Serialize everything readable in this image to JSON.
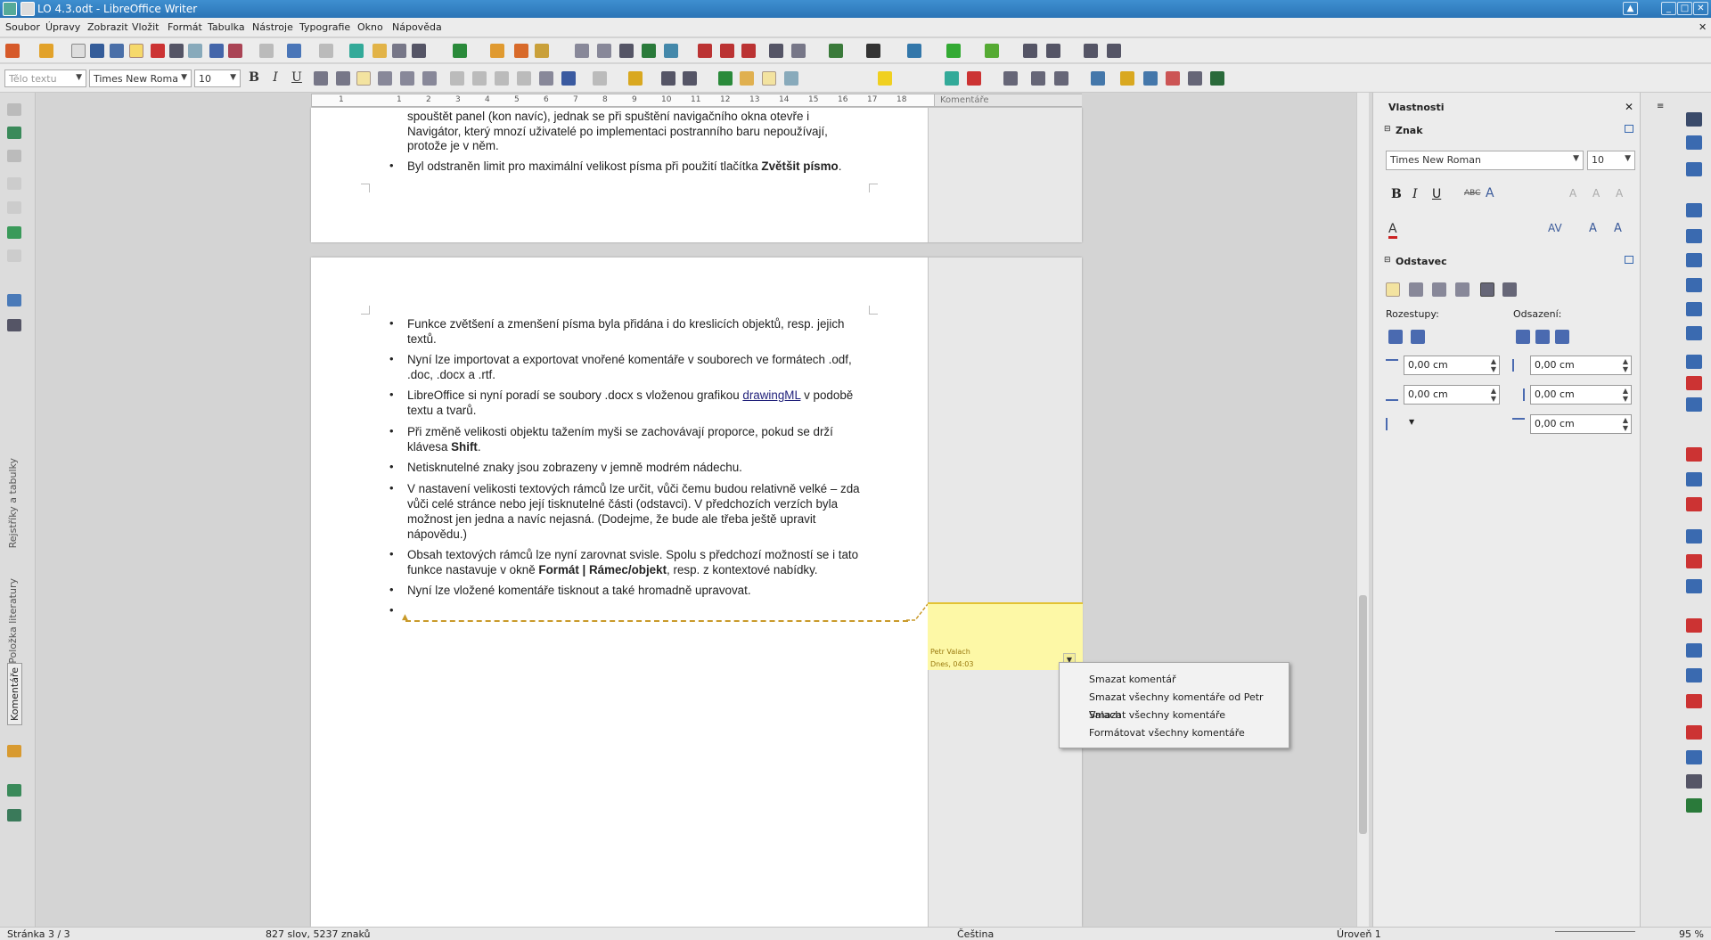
{
  "title_bar": {
    "title": "LO 4.3.odt - LibreOffice Writer"
  },
  "menu": [
    "Soubor",
    "Úpravy",
    "Zobrazit",
    "Vložit",
    "Formát",
    "Tabulka",
    "Nástroje",
    "Typografie",
    "Okno",
    "Nápověda"
  ],
  "toolbar": {
    "paragraph_style": "Tělo textu",
    "font_name": "Times New Roma",
    "font_size": "10",
    "bold": "B",
    "italic": "I",
    "underline": "U"
  },
  "ruler": {
    "comments_label": "Komentáře",
    "numbers": [
      "1",
      "1",
      "2",
      "3",
      "4",
      "5",
      "6",
      "7",
      "8",
      "9",
      "10",
      "11",
      "12",
      "13",
      "14",
      "15",
      "16",
      "17",
      "18"
    ]
  },
  "left_panel": {
    "tab_registers": "Rejstříky a tabulky",
    "tab_library": "Položka literatury",
    "tab_comments": "Komentáře"
  },
  "page1": {
    "line1": "spouštět panel (kon navíc), jednak se při spuštění navigačního okna otevře i",
    "line2": "Navigátor, který mnozí uživatelé po implementaci postranního baru nepoužívají,",
    "line3": "protože je v něm.",
    "bullet_plain": "Byl odstraněn limit pro maximální velikost písma při použití tlačítka ",
    "bullet_bold": "Zvětšit písmo",
    "bullet_end": "."
  },
  "page2": {
    "b1": "Funkce zvětšení a zmenšení písma byla přidána i do kreslicích objektů, resp. jejich textů.",
    "b2": "Nyní lze importovat a exportovat vnořené komentáře v souborech ve formátech .odf, .doc, .docx a .rtf.",
    "b3_pre": "LibreOffice si nyní poradí se soubory .docx s vloženou grafikou ",
    "b3_link": "drawingML",
    "b3_post": " v podobě textu a tvarů.",
    "b4_pre": "Při změně velikosti objektu tažením myši se zachovávají proporce, pokud se drží klávesa ",
    "b4_bold": "Shift",
    "b4_post": ".",
    "b5": "Netisknutelné znaky jsou zobrazeny v jemně modrém nádechu.",
    "b6": "V nastavení velikosti textových rámců lze určit, vůči čemu budou relativně velké – zda vůči celé stránce nebo její tisknutelné části (odstavci). V předchozích verzích byla možnost jen jedna a navíc nejasná. (Dodejme, že bude ale třeba ještě upravit nápovědu.)",
    "b7_pre": "Obsah textových rámců lze nyní zarovnat svisle. Spolu s předchozí možností se i tato funkce nastavuje v okně ",
    "b7_bold": "Formát | Rámec/objekt",
    "b7_post": ", resp. z kontextové nabídky.",
    "b8": "Nyní lze vložené komentáře tisknout a také hromadně upravovat.",
    "bullet": "•"
  },
  "comment": {
    "author": "Petr Valach",
    "date": "Dnes, 04:03"
  },
  "context_menu": [
    "Smazat komentář",
    "Smazat všechny komentáře od Petr Valach",
    "Smazat všechny komentáře",
    "Formátovat všechny komentáře"
  ],
  "sidebar": {
    "title": "Vlastnosti",
    "char_section": "Znak",
    "font_name": "Times New Roman",
    "font_size": "10",
    "para_section": "Odstavec",
    "spacing_label": "Rozestupy:",
    "indent_label": "Odsazení:",
    "above": "0,00 cm",
    "below": "0,00 cm",
    "before": "0,00 cm",
    "after": "0,00 cm",
    "first_line": "0,00 cm"
  },
  "status": {
    "page": "Stránka 3 / 3",
    "words": "827 slov, 5237 znaků",
    "language": "Čeština",
    "level": "Úroveň 1",
    "zoom": "95 %"
  },
  "colors": {
    "titlebar": "#2b74b6",
    "comment_bg": "#fdf8a6",
    "comment_anchor": "#c99a2a"
  }
}
